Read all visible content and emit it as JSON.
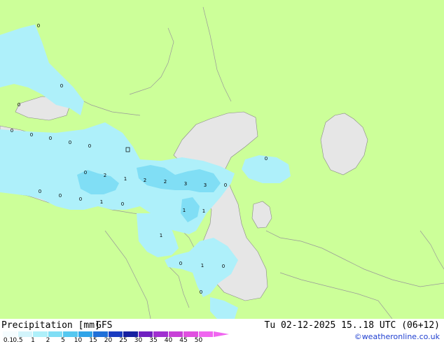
{
  "title": "Precipitation [mm]",
  "model": "GFS",
  "valid_time": "Tu 02-12-2025 15..18 UTC (06+12)",
  "credit": "©weatheronline.co.uk",
  "colors": {
    "land": "#ccff99",
    "sea": "#e6e6e6",
    "border": "#999999",
    "light_precip": "#aef0fa",
    "moderate_precip": "#80def5"
  },
  "legend": {
    "labels": [
      "0.1",
      "0.5",
      "1",
      "2",
      "5",
      "10",
      "15",
      "20",
      "25",
      "30",
      "35",
      "40",
      "45",
      "50"
    ],
    "colors": [
      "#f5fcfe",
      "#d2f4fb",
      "#aef0fa",
      "#80def5",
      "#56c8f0",
      "#2fa4e8",
      "#2070d8",
      "#1a3cc0",
      "#1620a0",
      "#7020c0",
      "#a030d0",
      "#c840d8",
      "#e050e0",
      "#f066f0"
    ]
  },
  "precip_labels": [
    "0",
    "0",
    "0",
    "0",
    "0",
    "0",
    "0",
    "0",
    "0",
    "2",
    "1",
    "2",
    "2",
    "3",
    "3",
    "0",
    "0",
    "0",
    "0",
    "0",
    "1",
    "0",
    "1",
    "1",
    "1",
    "0",
    "1",
    "0",
    "0",
    "0",
    "0"
  ]
}
